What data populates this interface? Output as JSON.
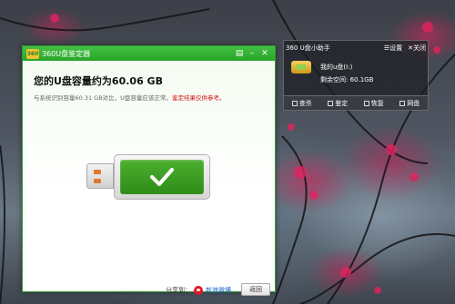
{
  "dialog": {
    "title": "360U盘鉴定器",
    "logo_text": "360",
    "capacity": "您的U盘容量约为60.06 GB",
    "desc_prefix": "与系统识别容量60.31 GB对比，U盘容量应该正常。",
    "desc_warning": "鉴定结果仅供参考。",
    "share_label": "分享到：",
    "share_link": "新浪微博",
    "back_button": "返回",
    "status_icon": "check-icon",
    "colors": {
      "titlebar": "#2fae2f",
      "warning": "#d01010",
      "link": "#1766c9"
    }
  },
  "helper": {
    "title": "360 U盘小助手",
    "settings": "设置",
    "close": "关闭",
    "drive_name": "我的u盘(I:)",
    "free_space": "剩余空间: 60.1GB",
    "actions": [
      "查杀",
      "鉴定",
      "恢复",
      "网盘"
    ]
  }
}
